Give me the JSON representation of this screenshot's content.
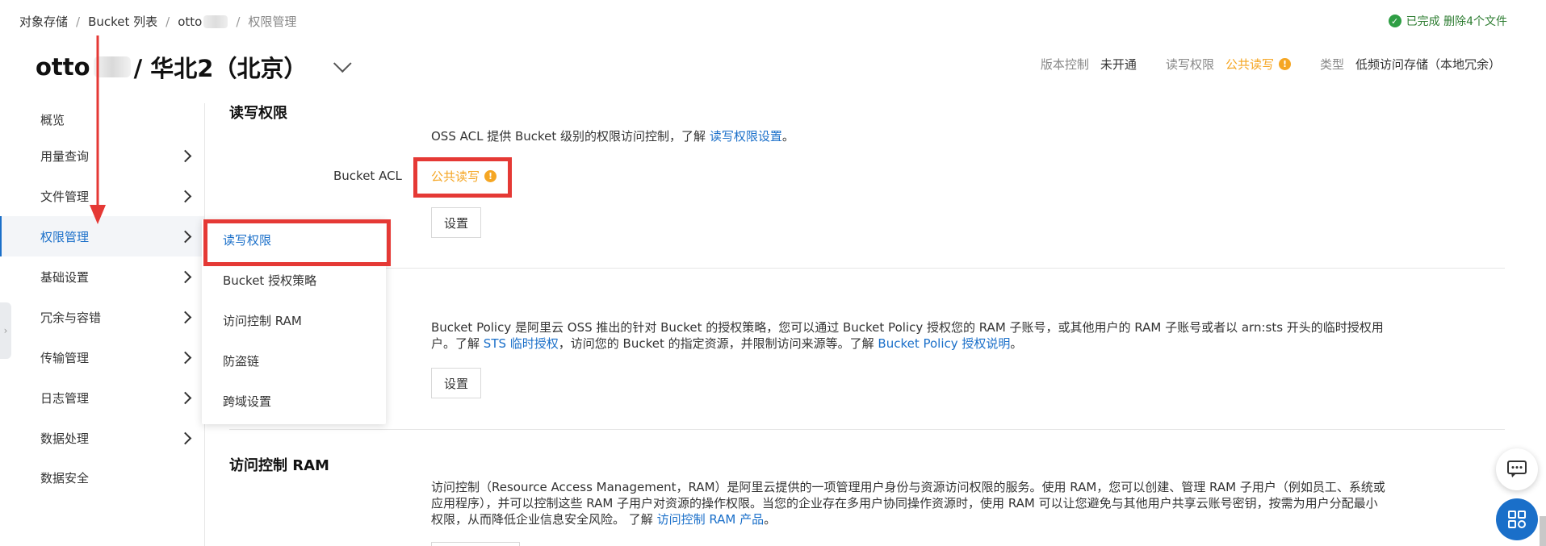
{
  "breadcrumb": {
    "items": [
      "对象存储",
      "Bucket 列表",
      "otto",
      "权限管理"
    ],
    "sep": "/"
  },
  "status": {
    "icon": "check-circle-icon",
    "text": "已完成 删除4个文件"
  },
  "header": {
    "bucket_prefix": "otto",
    "bucket_suffix": "/ 华北2（北京）",
    "meta": [
      {
        "key": "版本控制",
        "value": "未开通"
      },
      {
        "key": "读写权限",
        "value": "公共读写",
        "warn": true
      },
      {
        "key": "类型",
        "value": "低频访问存储（本地冗余）"
      }
    ]
  },
  "sidebar": {
    "items": [
      {
        "label": "概览",
        "chevron": false
      },
      {
        "label": "用量查询",
        "chevron": true
      },
      {
        "label": "文件管理",
        "chevron": true
      },
      {
        "label": "权限管理",
        "chevron": true,
        "active": true
      },
      {
        "label": "基础设置",
        "chevron": true
      },
      {
        "label": "冗余与容错",
        "chevron": true
      },
      {
        "label": "传输管理",
        "chevron": true
      },
      {
        "label": "日志管理",
        "chevron": true
      },
      {
        "label": "数据处理",
        "chevron": true
      },
      {
        "label": "数据安全",
        "chevron": false
      }
    ]
  },
  "submenu": {
    "items": [
      "读写权限",
      "Bucket 授权策略",
      "访问控制 RAM",
      "防盗链",
      "跨域设置"
    ]
  },
  "rw_section": {
    "title": "读写权限",
    "desc_text": "OSS ACL 提供 Bucket 级别的权限访问控制，了解",
    "desc_link": "读写权限设置",
    "desc_end": "。",
    "acl_label": "Bucket ACL",
    "acl_value": "公共读写",
    "set_button": "设置"
  },
  "policy_section": {
    "desc1": "Bucket Policy 是阿里云 OSS 推出的针对 Bucket 的授权策略，您可以通过 Bucket Policy 授权您的 RAM 子账号，或其他用户的 RAM 子账号或者以 arn:sts 开头的临时授权用",
    "desc2a": "户。了解",
    "desc2_link1": "STS 临时授权",
    "desc2b": "，访问您的 Bucket 的指定资源，并限制访问来源等。了解",
    "desc2_link2": "Bucket Policy 授权说明",
    "desc2c": "。",
    "set_button": "设置"
  },
  "ram_section": {
    "title": "访问控制 RAM",
    "desc1": "访问控制（Resource Access Management，RAM）是阿里云提供的一项管理用户身份与资源访问权限的服务。使用 RAM，您可以创建、管理 RAM 子用户（例如员工、系统或",
    "desc2": "应用程序），并可以控制这些 RAM 子用户对资源的操作权限。当您的企业存在多用户协同操作资源时，使用 RAM 可以让您避免与其他用户共享云账号密钥，按需为用户分配最小",
    "desc3a": "权限，从而降低企业信息安全风险。 了解",
    "desc3_link": "访问控制 RAM 产品",
    "desc3b": "。"
  },
  "colors": {
    "accent": "#1a6fc9",
    "warning": "#f5a623",
    "annotation": "#e53935",
    "success": "#2e9e44"
  }
}
